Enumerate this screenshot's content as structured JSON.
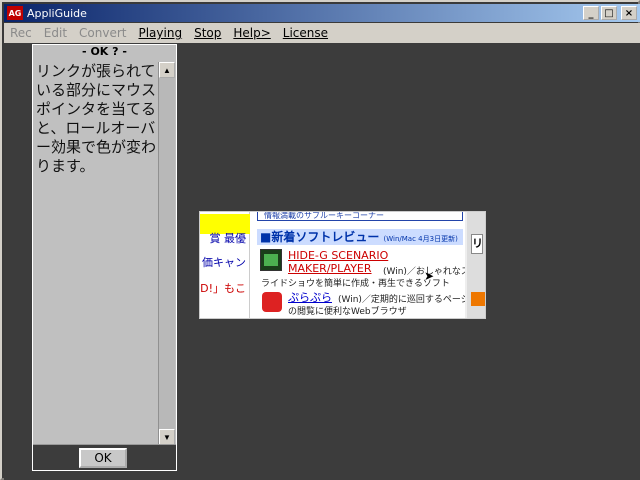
{
  "window": {
    "app_icon_text": "AG",
    "title": "AppliGuide",
    "controls": {
      "minimize": "_",
      "maximize": "□",
      "close": "×"
    }
  },
  "menu": {
    "items": [
      {
        "label": "Rec",
        "enabled": false
      },
      {
        "label": "Edit",
        "enabled": false
      },
      {
        "label": "Convert",
        "enabled": false
      },
      {
        "label": "Playing",
        "enabled": true
      },
      {
        "label": "Stop",
        "enabled": true
      },
      {
        "label": "Help>",
        "enabled": true
      },
      {
        "label": "License",
        "enabled": true
      }
    ]
  },
  "guide": {
    "header": "- OK ? -",
    "text": "リンクが張られている部分にマウスポインタを当てると、ロールオーバー効果で色が変わります。",
    "ok_label": "OK"
  },
  "preview": {
    "left_items": [
      "賞 最優",
      "価キャン",
      "ND!」もこ"
    ],
    "top_bar_text": "情報満載のサブルーキーコーナー",
    "section_title": "■新着ソフトレビュー",
    "section_date": "(Win/Mac 4月3日更新)",
    "entry1_title_line1": "HIDE-G SCENARIO",
    "entry1_title_line2": "MAKER/PLAYER",
    "entry1_platform": "(Win)／おしゃれなス",
    "entry1_desc": "ライドショウを簡単に作成・再生できるソフト",
    "entry2_title": "ぷらぷら",
    "entry2_platform": "(Win)／定期的に巡回するページ",
    "entry2_desc": "の閲覧に便利なWebブラウザ",
    "right_char": "リ"
  },
  "colors": {
    "titlebar_start": "#0a246a",
    "titlebar_end": "#a6caf0",
    "workspace": "#3c3c3c",
    "link_red": "#cc0000"
  }
}
